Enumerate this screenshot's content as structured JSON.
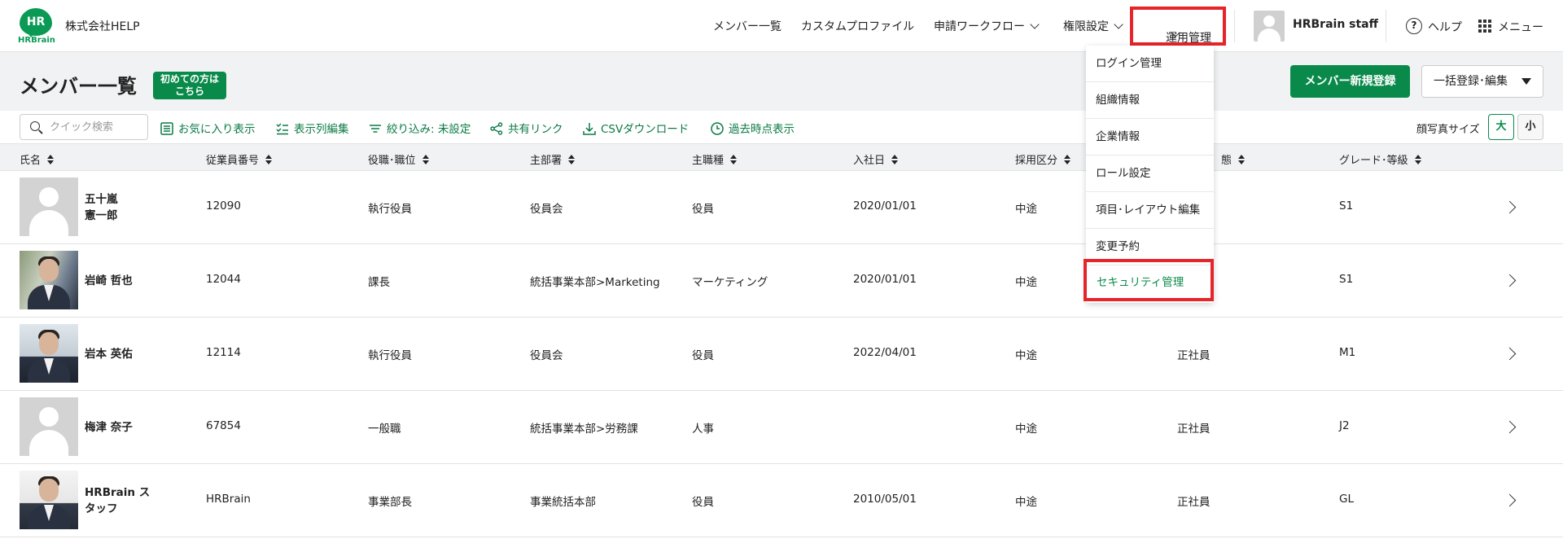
{
  "header": {
    "logo_text": "HR",
    "logo_brand": "HRBrain",
    "company": "株式会社HELP",
    "nav": [
      {
        "label": "メンバー一覧"
      },
      {
        "label": "カスタムプロファイル"
      },
      {
        "label": "申請ワークフロー"
      },
      {
        "label": "権限設定"
      },
      {
        "label": "運用管理"
      }
    ],
    "user_name": "HRBrain staff",
    "help_label": "ヘルプ",
    "help_glyph": "?",
    "menu_label": "メニュー"
  },
  "title_band": {
    "title": "メンバー一覧",
    "beginner_line1": "初めての方は",
    "beginner_line2": "こちら",
    "new_member_button": "メンバー新規登録",
    "bulk_button": "一括登録･編集"
  },
  "toolbar": {
    "search_placeholder": "クイック検索",
    "favorites": "お気に入り表示",
    "columns": "表示列編集",
    "filter": "絞り込み: 未設定",
    "share": "共有リンク",
    "csv": "CSVダウンロード",
    "history": "過去時点表示",
    "face_size_label": "顔写真サイズ",
    "size_large": "大",
    "size_small": "小"
  },
  "table": {
    "columns": [
      "氏名",
      "従業員番号",
      "役職･職位",
      "主部署",
      "主職種",
      "入社日",
      "採用区分",
      "態",
      "グレード･等級"
    ],
    "rows": [
      {
        "name": "五十嵐\n憲一郎",
        "photo": "placeholder",
        "emp_no": "12090",
        "position": "執行役員",
        "dept": "役員会",
        "job": "役員",
        "join_date": "2020/01/01",
        "hire_type": "中途",
        "status": "",
        "grade": "S1"
      },
      {
        "name": "岩崎 哲也",
        "photo": "pic1",
        "emp_no": "12044",
        "position": "課長",
        "dept": "統括事業本部>Marketing",
        "job": "マーケティング",
        "join_date": "2020/01/01",
        "hire_type": "中途",
        "status": "",
        "grade": "S1"
      },
      {
        "name": "岩本 英佑",
        "photo": "pic2",
        "emp_no": "12114",
        "position": "執行役員",
        "dept": "役員会",
        "job": "役員",
        "join_date": "2022/04/01",
        "hire_type": "中途",
        "status": "正社員",
        "grade": "M1"
      },
      {
        "name": "梅津 奈子",
        "photo": "placeholder",
        "emp_no": "67854",
        "position": "一般職",
        "dept": "統括事業本部>労務課",
        "job": "人事",
        "join_date": "",
        "hire_type": "中途",
        "status": "正社員",
        "grade": "J2"
      },
      {
        "name": "HRBrain ス\nタッフ",
        "photo": "pic3",
        "emp_no": "HRBrain",
        "position": "事業部長",
        "dept": "事業統括本部",
        "job": "役員",
        "join_date": "2010/05/01",
        "hire_type": "中途",
        "status": "正社員",
        "grade": "GL"
      }
    ]
  },
  "dropdown": {
    "items": [
      "ログイン管理",
      "組織情報",
      "企業情報",
      "ロール設定",
      "項目･レイアウト編集",
      "変更予約",
      "セキュリティ管理"
    ]
  },
  "colors": {
    "brand_green": "#0a8a4a",
    "highlight_red": "#e5252a"
  }
}
